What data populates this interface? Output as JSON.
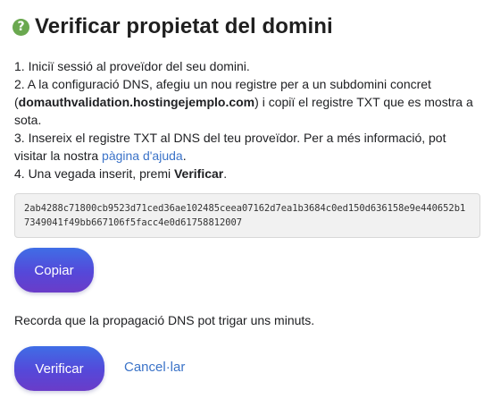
{
  "header": {
    "icon": "help-icon",
    "icon_glyph": "?",
    "icon_color": "#6aa84f",
    "title": "Verificar propietat del domini"
  },
  "steps": {
    "step1": "1. Iniciï sessió al proveïdor del seu domini.",
    "step2_before": "2. A la configuració DNS, afegiu un nou registre per a un subdomini concret (",
    "step2_domain": "domauthvalidation.hostingejemplo.com",
    "step2_after": ") i copiï el registre TXT que es mostra a sota.",
    "step3_before": "3. Insereix el registre TXT al DNS del teu proveïdor. Per a més informació, pot visitar la nostra ",
    "step3_link": "pàgina d'ajuda",
    "step3_after": ".",
    "step4_before": "4. Una vegada inserit, premi ",
    "step4_bold": "Verificar",
    "step4_after": "."
  },
  "txt_record": "2ab4288c71800cb9523d71ced36ae102485ceea07162d7ea1b3684c0ed150d636158e9e440652b17349041f49bb667106f5facc4e0d61758812007",
  "buttons": {
    "copy_label": "Copiar",
    "verify_label": "Verificar",
    "cancel_label": "Cancel·lar"
  },
  "note": "Recorda que la propagació DNS pot trigar uns minuts.",
  "colors": {
    "accent_link": "#3b73c8",
    "button_gradient_start": "#3f6ee6",
    "button_gradient_end": "#6a3cc8"
  }
}
